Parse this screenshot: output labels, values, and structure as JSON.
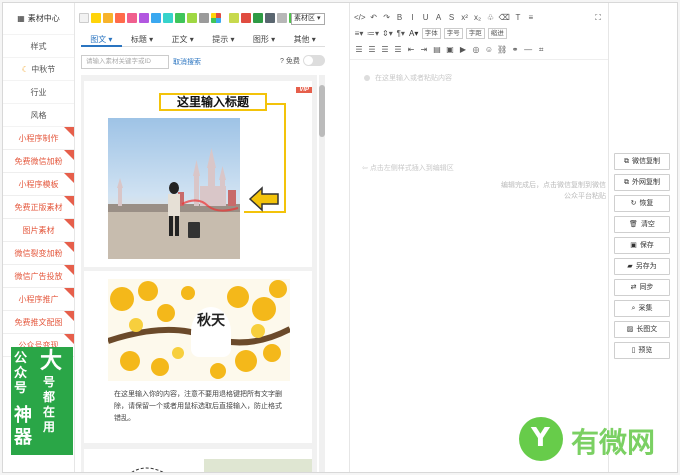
{
  "left_nav": {
    "header": "素材中心",
    "items": [
      {
        "label": "样式",
        "style": "normal"
      },
      {
        "label": "中秋节",
        "style": "festival"
      },
      {
        "label": "行业",
        "style": "normal"
      },
      {
        "label": "风格",
        "style": "normal"
      },
      {
        "label": "小程序制作",
        "style": "red"
      },
      {
        "label": "免费微信加粉",
        "style": "red"
      },
      {
        "label": "小程序模板",
        "style": "red"
      },
      {
        "label": "免费正版素材",
        "style": "red"
      },
      {
        "label": "图片素材",
        "style": "red"
      },
      {
        "label": "微信裂变加粉",
        "style": "red"
      },
      {
        "label": "微信广告投放",
        "style": "red"
      },
      {
        "label": "小程序推广",
        "style": "red"
      },
      {
        "label": "免费推文配图",
        "style": "red"
      },
      {
        "label": "公众号变现",
        "style": "red"
      }
    ],
    "promo": {
      "line1": "公众号",
      "big": "大",
      "line2": "号都在用",
      "line3": "神器"
    }
  },
  "panel": {
    "area_select": "素材区",
    "swatch_colors": [
      "#f2f2f2",
      "#ffd40a",
      "#f7b32b",
      "#ff6b4a",
      "#f05f8e",
      "#b257e0",
      "#3aa8f0",
      "#37d3cb",
      "#3fc55a",
      "#9fd843",
      "#9b9b9b"
    ],
    "swatch_colors2": [
      "#c7d94d",
      "#e04c40",
      "#2f9b45",
      "#5a6670",
      "#b7b7b7",
      "#4ec24a"
    ],
    "tabs": [
      {
        "label": "图文 ▾",
        "active": true
      },
      {
        "label": "标题 ▾",
        "active": false
      },
      {
        "label": "正文 ▾",
        "active": false
      },
      {
        "label": "提示 ▾",
        "active": false
      },
      {
        "label": "图形 ▾",
        "active": false
      },
      {
        "label": "其他 ▾",
        "active": false
      }
    ],
    "search_placeholder": "请输入素材关键字或ID",
    "clear_search": "取消搜索",
    "free_label": "免费",
    "card1": {
      "vip": "VIP",
      "title": "这里输入标题"
    },
    "card2": {
      "autumn": "秋天",
      "paragraph": "在这里输入你的内容，注意不要用退格键把所有文字删除，请保留一个或者用鼠标选取后直接输入，防止格式错乱。"
    }
  },
  "editor": {
    "row1": [
      "</>",
      "↶",
      "↷",
      "B",
      "I",
      "U",
      "A",
      "S",
      "x²",
      "x₂",
      "♧",
      "⌫",
      "T",
      "≡",
      "⛶"
    ],
    "row2_dropdowns": [
      "字体",
      "字号",
      "字距",
      "缩进"
    ],
    "placeholder_top": "在这里输入或者粘贴内容",
    "placeholder_mid": "点击左侧样式插入到编辑区",
    "tip": "编辑完成后，点击微信复制到微信公众平台粘贴"
  },
  "actions": [
    {
      "label": "微信复制",
      "icon": "copy-icon"
    },
    {
      "label": "外网复制",
      "icon": "copy-icon"
    },
    {
      "label": "恢复",
      "icon": "restore-icon"
    },
    {
      "label": "清空",
      "icon": "trash-icon"
    },
    {
      "label": "保存",
      "icon": "save-icon"
    },
    {
      "label": "另存为",
      "icon": "folder-icon"
    },
    {
      "label": "同步",
      "icon": "sync-icon"
    },
    {
      "label": "采集",
      "icon": "search-icon"
    },
    {
      "label": "长图文",
      "icon": "image-icon"
    },
    {
      "label": "预览",
      "icon": "phone-icon"
    }
  ],
  "watermark": {
    "text": "有微网"
  }
}
